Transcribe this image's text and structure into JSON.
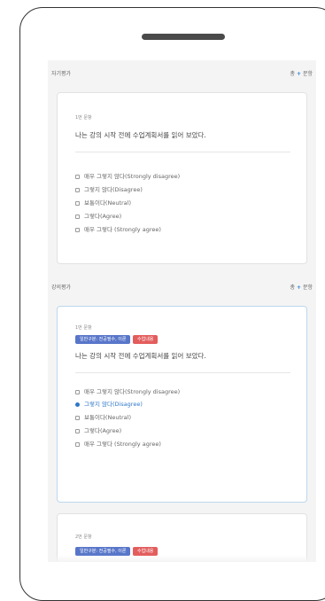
{
  "sections": [
    {
      "title": "자기평가",
      "count_prefix": "총",
      "count_plus": "+",
      "count_suffix": "문항"
    },
    {
      "title": "강의평가",
      "count_prefix": "총",
      "count_plus": "+",
      "count_suffix": "문항"
    }
  ],
  "cards": [
    {
      "qnum": "1번 문항",
      "question": "나는 강의 시작 전에 수업계획서를 읽어 보았다.",
      "options": [
        "매우 그렇지 않다(Strongly disagree)",
        "그렇지 않다(Disagree)",
        "보통이다(Neutral)",
        "그렇다(Agree)",
        "매우 그렇다 (Strongly agree)"
      ]
    },
    {
      "qnum": "1번 문항",
      "tags": [
        "일반구분: 전공필수, 이론",
        "수업내용"
      ],
      "question": "나는 강의 시작 전에 수업계획서를 읽어 보았다.",
      "options": [
        "매우 그렇지 않다(Strongly disagree)",
        "그렇지 않다(Disagree)",
        "보통이다(Neutral)",
        "그렇다(Agree)",
        "매우 그렇다 (Strongly agree)"
      ],
      "selected": "그렇지 않다(Disagree)"
    },
    {
      "qnum": "2번 문항",
      "tags": [
        "일반구분: 전공필수, 이론",
        "수업내용"
      ]
    }
  ]
}
